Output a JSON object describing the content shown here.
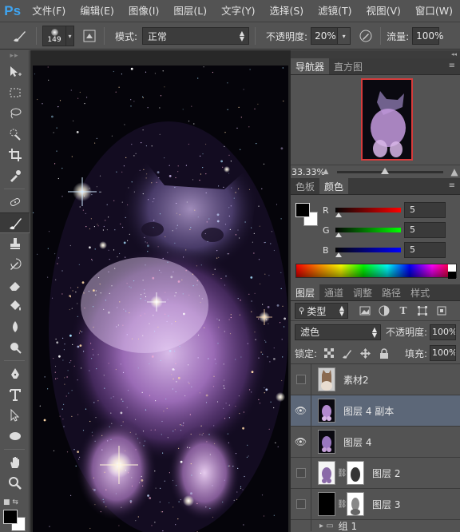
{
  "app": {
    "logo": "Ps",
    "menu": [
      "文件(F)",
      "编辑(E)",
      "图像(I)",
      "图层(L)",
      "文字(Y)",
      "选择(S)",
      "滤镜(T)",
      "视图(V)",
      "窗口(W)"
    ]
  },
  "options": {
    "brush_size": "149",
    "mode_label": "模式:",
    "mode_value": "正常",
    "opacity_label": "不透明度:",
    "opacity_value": "20%",
    "flow_label": "流量:",
    "flow_value": "100%"
  },
  "navigator": {
    "tabs": [
      "导航器",
      "直方图"
    ],
    "zoom": "33.33%",
    "zoom_level_fraction": 0.45
  },
  "color": {
    "tabs": [
      "色板",
      "颜色"
    ],
    "channels": [
      {
        "label": "R",
        "value": "5",
        "color": "#e02020"
      },
      {
        "label": "G",
        "value": "5",
        "color": "#20d020"
      },
      {
        "label": "B",
        "value": "5",
        "color": "#2050e0"
      }
    ],
    "foreground": "#000000",
    "background": "#ffffff"
  },
  "layers": {
    "tabs": [
      "图层",
      "通道",
      "调整",
      "路径",
      "样式"
    ],
    "kind_label": "类型",
    "blend_mode": "滤色",
    "opacity_label": "不透明度:",
    "opacity_value": "100%",
    "lock_label": "锁定:",
    "fill_label": "填充:",
    "fill_value": "100%",
    "items": [
      {
        "name": "素材2",
        "visible": false,
        "selected": false,
        "thumb": "kitten"
      },
      {
        "name": "图层 4 副本",
        "visible": true,
        "selected": true,
        "thumb": "galaxy"
      },
      {
        "name": "图层 4",
        "visible": true,
        "selected": false,
        "thumb": "galaxy"
      },
      {
        "name": "图层 2",
        "visible": false,
        "selected": false,
        "thumb": "galaxy-white",
        "mask": true
      },
      {
        "name": "图层 3",
        "visible": false,
        "selected": false,
        "thumb": "black",
        "mask": true
      }
    ],
    "group_name": "组 1"
  },
  "accent": {
    "selection": "#5c6778",
    "nav_frame": "#d63c3c",
    "ps_blue": "#3fa5f2"
  }
}
